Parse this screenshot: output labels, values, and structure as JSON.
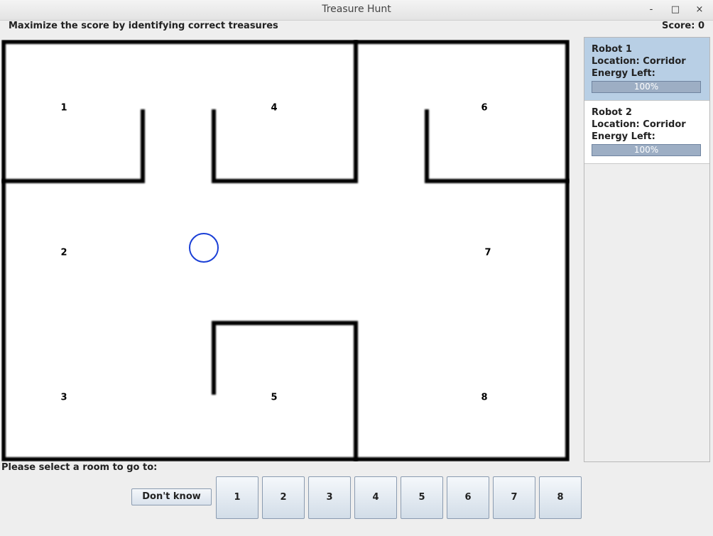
{
  "window": {
    "title": "Treasure Hunt",
    "minimize_glyph": "-",
    "maximize_glyph": "□",
    "close_glyph": "×"
  },
  "header": {
    "instruction": "Maximize the score by identifying correct treasures",
    "score": "Score: 0"
  },
  "maze": {
    "rooms": [
      "1",
      "2",
      "3",
      "4",
      "5",
      "6",
      "7",
      "8"
    ],
    "wall_color": "#000000",
    "robot_marker_color": "#1a3fd6"
  },
  "robots": [
    {
      "name": "Robot 1",
      "location": "Location: Corridor",
      "energy_label": "Energy Left:",
      "energy": "100%",
      "selected": true
    },
    {
      "name": "Robot 2",
      "location": "Location: Corridor",
      "energy_label": "Energy Left:",
      "energy": "100%",
      "selected": false
    }
  ],
  "controls": {
    "prompt": "Please select a room to go to:",
    "dont_know": "Don't know",
    "room_buttons": [
      "1",
      "2",
      "3",
      "4",
      "5",
      "6",
      "7",
      "8"
    ]
  },
  "colors": {
    "selected_card": "#b8cfe5",
    "energy_bar": "#9daec4"
  }
}
